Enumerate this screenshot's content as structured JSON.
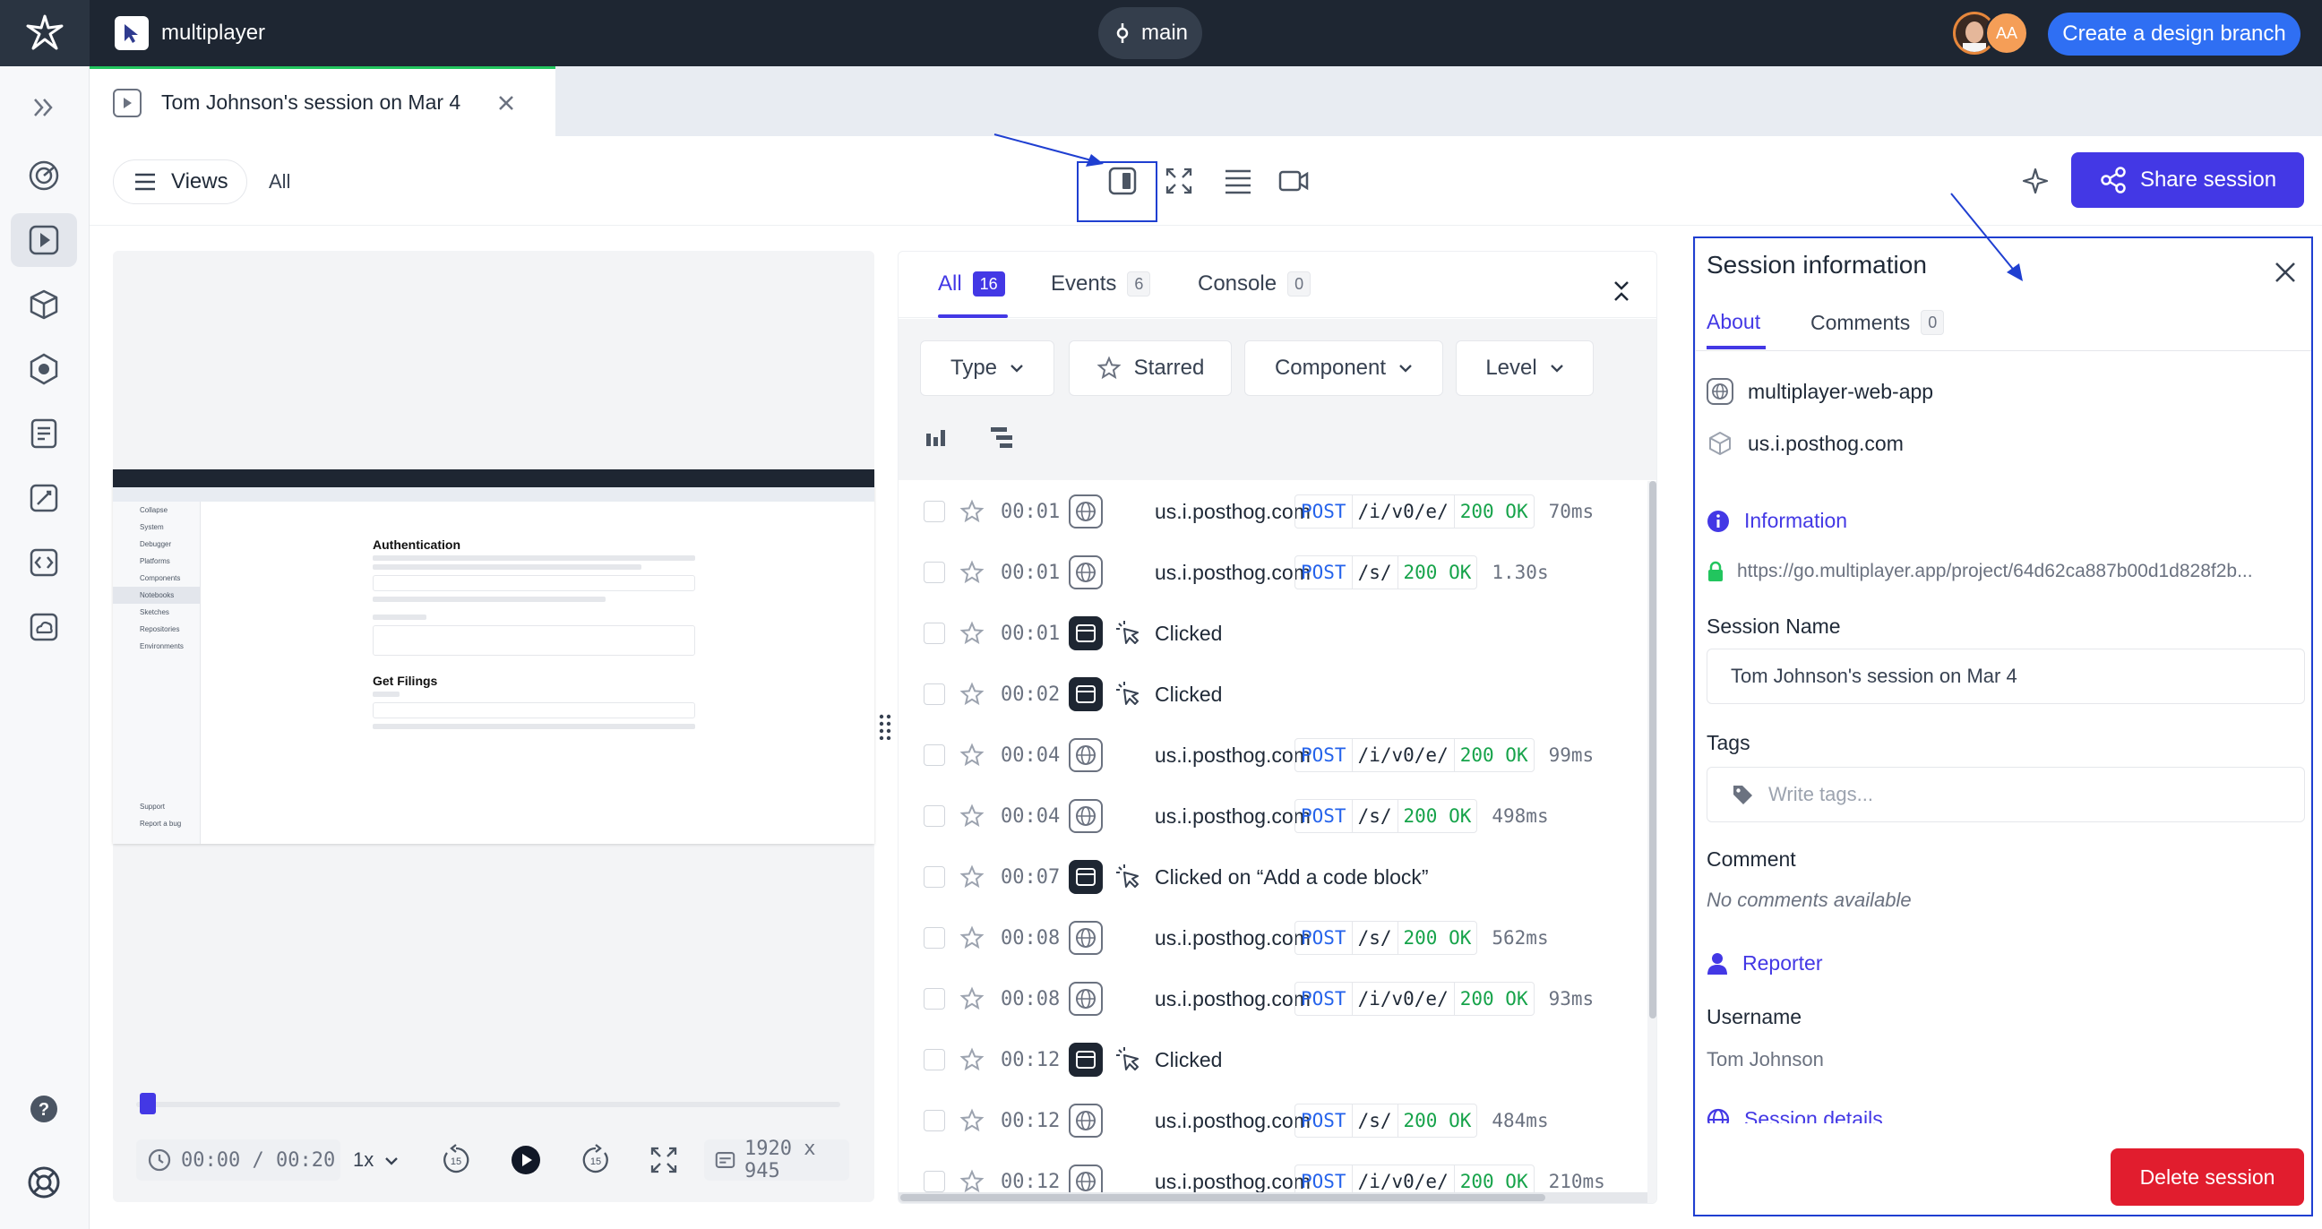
{
  "topbar": {
    "app_name": "multiplayer",
    "branch": "main",
    "avatar_initials": "AA",
    "create_branch_label": "Create a design branch"
  },
  "sidebar": {
    "items": [
      {
        "icon": "chevrons-right-icon"
      },
      {
        "icon": "dashboard-icon"
      },
      {
        "icon": "session-play-icon",
        "active": true
      },
      {
        "icon": "cube-icon"
      },
      {
        "icon": "platform-icon"
      },
      {
        "icon": "notebook-icon"
      },
      {
        "icon": "sketch-icon"
      },
      {
        "icon": "code-icon"
      },
      {
        "icon": "cloud-icon"
      },
      {
        "icon": "help-icon"
      },
      {
        "icon": "support-lifebuoy-icon"
      }
    ]
  },
  "tab": {
    "title": "Tom Johnson's session on Mar 4"
  },
  "toolbar": {
    "views_label": "Views",
    "all_label": "All",
    "share_label": "Share session"
  },
  "player": {
    "time": "00:00 / 00:20",
    "speed": "1x",
    "resolution": "1920 x 945",
    "progress": 0.0,
    "preview": {
      "heading1": "Authentication",
      "heading2": "Get Filings",
      "nav": [
        "Collapse",
        "System",
        "Debugger",
        "Platforms",
        "Components",
        "Notebooks",
        "Sketches",
        "Repositories",
        "Environments",
        "Support",
        "Report a bug"
      ]
    }
  },
  "events": {
    "tabs": [
      {
        "label": "All",
        "count": "16",
        "active": true
      },
      {
        "label": "Events",
        "count": "6"
      },
      {
        "label": "Console",
        "count": "0"
      }
    ],
    "filters": {
      "type": "Type",
      "starred": "Starred",
      "component": "Component",
      "level": "Level"
    },
    "rows": [
      {
        "time": "00:01",
        "kind": "net",
        "label": "us.i.posthog.com",
        "method": "POST",
        "path": "/i/v0/e/",
        "status": "200 OK",
        "duration": "70ms"
      },
      {
        "time": "00:01",
        "kind": "net",
        "label": "us.i.posthog.com",
        "method": "POST",
        "path": "/s/",
        "status": "200 OK",
        "duration": "1.30s"
      },
      {
        "time": "00:01",
        "kind": "click",
        "label": "Clicked"
      },
      {
        "time": "00:02",
        "kind": "click",
        "label": "Clicked"
      },
      {
        "time": "00:04",
        "kind": "net",
        "label": "us.i.posthog.com",
        "method": "POST",
        "path": "/i/v0/e/",
        "status": "200 OK",
        "duration": "99ms"
      },
      {
        "time": "00:04",
        "kind": "net",
        "label": "us.i.posthog.com",
        "method": "POST",
        "path": "/s/",
        "status": "200 OK",
        "duration": "498ms"
      },
      {
        "time": "00:07",
        "kind": "click",
        "label": "Clicked on “Add a code block”"
      },
      {
        "time": "00:08",
        "kind": "net",
        "label": "us.i.posthog.com",
        "method": "POST",
        "path": "/s/",
        "status": "200 OK",
        "duration": "562ms"
      },
      {
        "time": "00:08",
        "kind": "net",
        "label": "us.i.posthog.com",
        "method": "POST",
        "path": "/i/v0/e/",
        "status": "200 OK",
        "duration": "93ms"
      },
      {
        "time": "00:12",
        "kind": "click",
        "label": "Clicked"
      },
      {
        "time": "00:12",
        "kind": "net",
        "label": "us.i.posthog.com",
        "method": "POST",
        "path": "/s/",
        "status": "200 OK",
        "duration": "484ms"
      },
      {
        "time": "00:12",
        "kind": "net",
        "label": "us.i.posthog.com",
        "method": "POST",
        "path": "/i/v0/e/",
        "status": "200 OK",
        "duration": "210ms"
      }
    ]
  },
  "session_info": {
    "title": "Session information",
    "tabs": [
      {
        "label": "About",
        "active": true
      },
      {
        "label": "Comments",
        "count": "0"
      }
    ],
    "components": [
      "multiplayer-web-app",
      "us.i.posthog.com"
    ],
    "information_label": "Information",
    "url": "https://go.multiplayer.app/project/64d62ca887b00d1d828f2b...",
    "session_name_label": "Session Name",
    "session_name_value": "Tom Johnson's session on Mar 4",
    "tags_label": "Tags",
    "tags_placeholder": "Write tags...",
    "comment_label": "Comment",
    "comment_empty": "No comments available",
    "reporter_label": "Reporter",
    "username_label": "Username",
    "username_value": "Tom Johnson",
    "session_details_label": "Session details",
    "delete_label": "Delete session"
  },
  "colors": {
    "topbar": "#1e2632",
    "accent": "#4338e5",
    "create_branch": "#2f6ff3",
    "delete": "#e11d2e",
    "status_ok": "#16a34a",
    "method": "#2563eb",
    "annotation": "#1f3fd1"
  }
}
